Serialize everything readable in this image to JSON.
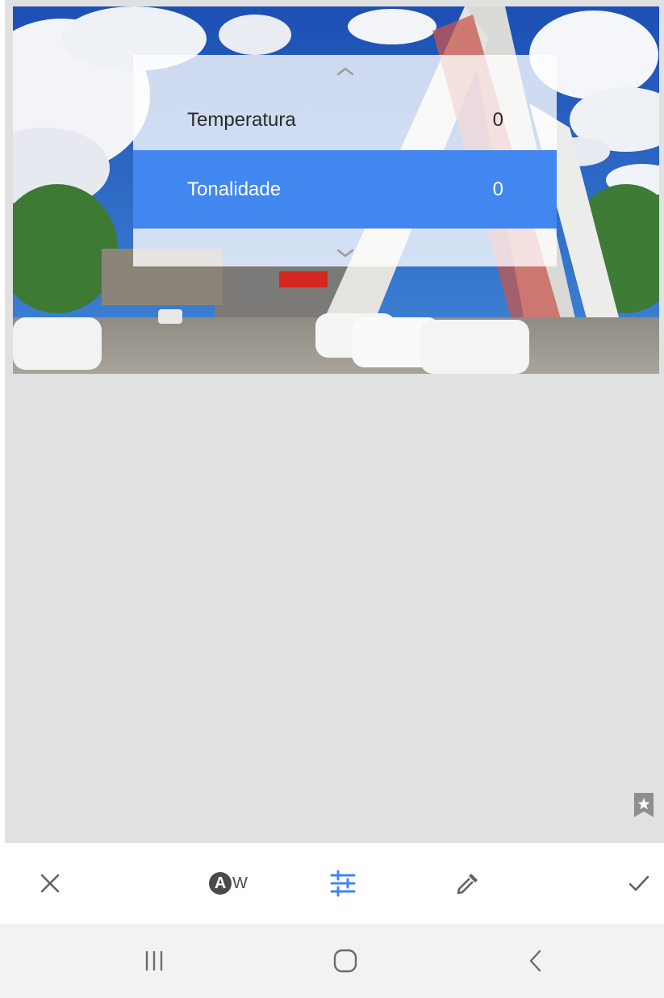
{
  "picker": {
    "items": [
      {
        "label": "Temperatura",
        "value": "0"
      },
      {
        "label": "Tonalidade",
        "value": "0"
      }
    ],
    "selected_index": 1
  },
  "toolbar": {
    "buttons": [
      "close-icon",
      "auto-white-balance-icon",
      "adjust-sliders-icon",
      "eyedropper-icon",
      "check-icon"
    ],
    "auto_wb_label": "W",
    "auto_wb_badge": "A"
  },
  "navbar": {
    "buttons": [
      "recent-apps-icon",
      "home-icon",
      "back-icon"
    ]
  },
  "colors": {
    "accent": "#4286f0",
    "canvas": "#e1e1e1",
    "icon": "#5f6368"
  }
}
